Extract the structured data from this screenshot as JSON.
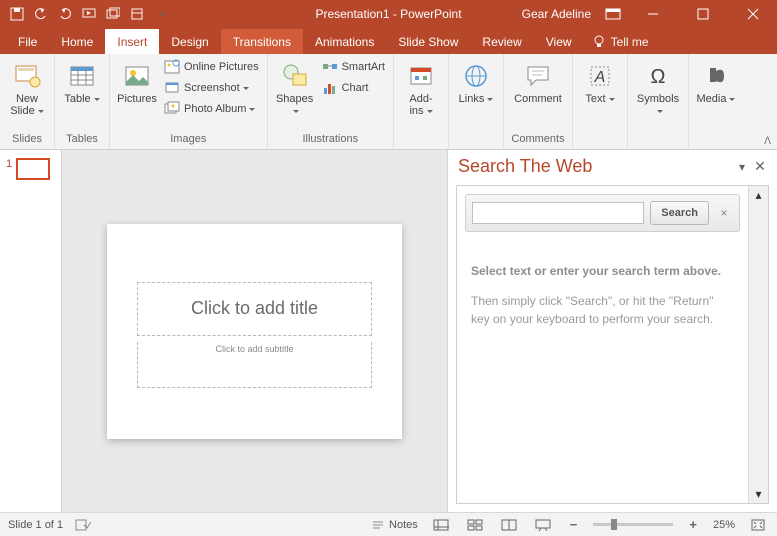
{
  "titlebar": {
    "title": "Presentation1 - PowerPoint",
    "user": "Gear Adeline"
  },
  "tabs": {
    "file": "File",
    "items": [
      "Home",
      "Insert",
      "Design",
      "Transitions",
      "Animations",
      "Slide Show",
      "Review",
      "View"
    ],
    "active_index": 1,
    "highlight_index": 3,
    "tellme": "Tell me"
  },
  "ribbon": {
    "slides": {
      "label": "Slides",
      "new_slide": "New\nSlide"
    },
    "tables": {
      "label": "Tables",
      "table": "Table"
    },
    "images": {
      "label": "Images",
      "pictures": "Pictures",
      "online_pictures": "Online Pictures",
      "screenshot": "Screenshot",
      "photo_album": "Photo Album"
    },
    "illustrations": {
      "label": "Illustrations",
      "shapes": "Shapes",
      "smartart": "SmartArt",
      "chart": "Chart"
    },
    "addins": {
      "label": "",
      "btn": "Add-\nins"
    },
    "links": {
      "label": "",
      "btn": "Links"
    },
    "comments": {
      "label": "Comments",
      "btn": "Comment"
    },
    "text": {
      "label": "",
      "btn": "Text"
    },
    "symbols": {
      "label": "",
      "btn": "Symbols"
    },
    "media": {
      "label": "",
      "btn": "Media"
    }
  },
  "thumbs": {
    "num": "1"
  },
  "slide": {
    "title_placeholder": "Click to add title",
    "subtitle_placeholder": "Click to add subtitle"
  },
  "pane": {
    "title": "Search The Web",
    "search_btn": "Search",
    "hint1": "Select text or enter your search term above.",
    "hint2a": "Then simply click \"Search\", or hit the \"Return\"",
    "hint2b": "key on your keyboard to perform your search."
  },
  "status": {
    "slide_info": "Slide 1 of 1",
    "notes": "Notes",
    "zoom": "25%"
  }
}
